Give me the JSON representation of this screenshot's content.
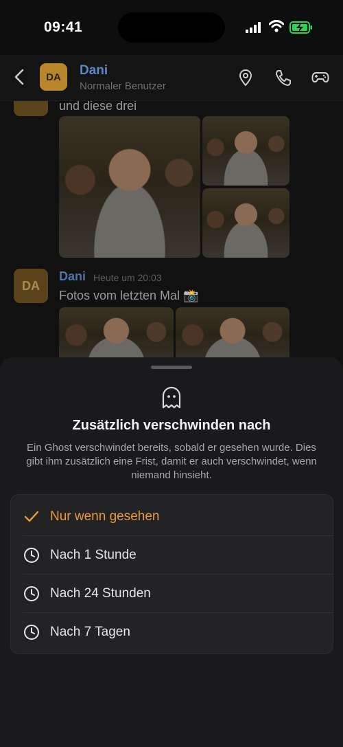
{
  "status_bar": {
    "time": "09:41"
  },
  "header": {
    "avatar_initials": "DA",
    "name": "Dani",
    "subtitle": "Normaler Benutzer",
    "icons": [
      "chevron-left-icon",
      "location-pin-icon",
      "phone-icon",
      "gamepad-icon"
    ]
  },
  "chat": {
    "msg1_text": "und diese drei",
    "msg2": {
      "avatar_initials": "DA",
      "sender": "Dani",
      "time": "Heute um 20:03",
      "text": "Fotos vom letzten Mal 📸"
    }
  },
  "sheet": {
    "icon": "ghost-icon",
    "title": "Zusätzlich verschwinden nach",
    "description": "Ein Ghost verschwindet bereits, sobald er gesehen wurde. Dies gibt ihm zusätzlich eine Frist, damit er auch verschwindet, wenn niemand hinsieht.",
    "options": [
      {
        "label": "Nur wenn gesehen",
        "icon": "checkmark-icon",
        "selected": true
      },
      {
        "label": "Nach 1 Stunde",
        "icon": "clock-icon",
        "selected": false
      },
      {
        "label": "Nach 24 Stunden",
        "icon": "clock-icon",
        "selected": false
      },
      {
        "label": "Nach 7 Tagen",
        "icon": "clock-icon",
        "selected": false
      }
    ]
  },
  "colors": {
    "accent": "#e79a3b",
    "name_blue": "#5b88c7",
    "avatar": "#b8862b"
  }
}
